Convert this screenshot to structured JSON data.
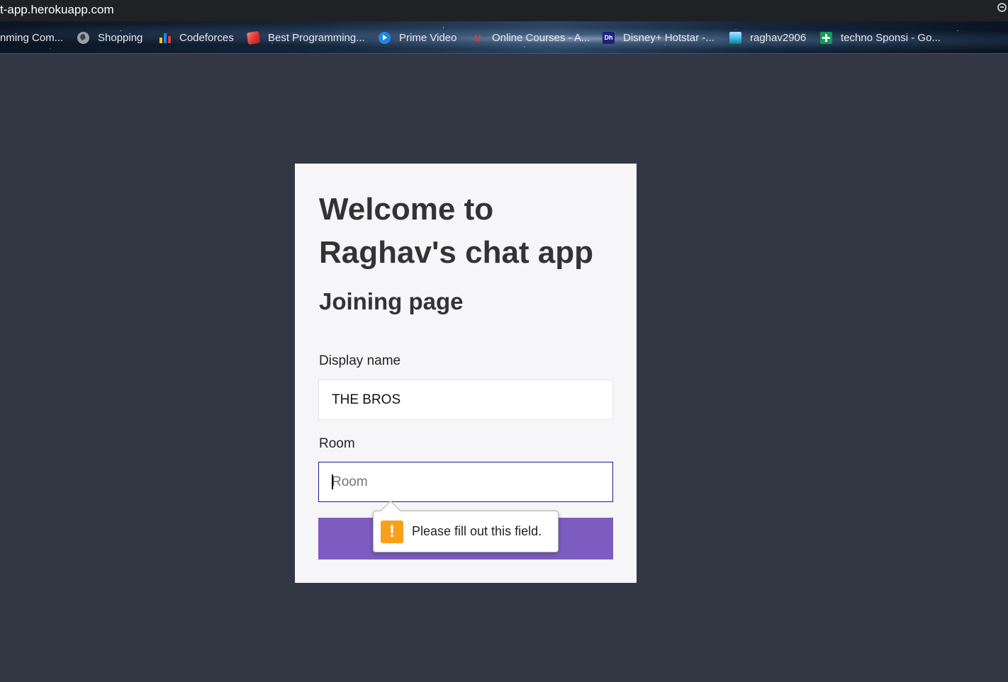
{
  "browser": {
    "url": "t-app.herokuapp.com",
    "bookmarks": [
      {
        "label": "nming Com...",
        "icon": "none"
      },
      {
        "label": "Shopping",
        "icon": "globe-icon"
      },
      {
        "label": "Codeforces",
        "icon": "codeforces-icon"
      },
      {
        "label": "Best Programming...",
        "icon": "box-icon"
      },
      {
        "label": "Prime Video",
        "icon": "prime-video-icon"
      },
      {
        "label": "Online Courses - A...",
        "icon": "online-courses-icon"
      },
      {
        "label": "Disney+ Hotstar -...",
        "icon": "hotstar-icon"
      },
      {
        "label": "raghav2906",
        "icon": "avatar-icon"
      },
      {
        "label": "techno Sponsi - Go...",
        "icon": "sheets-icon"
      }
    ]
  },
  "card": {
    "title": "Welcome to Raghav's chat app",
    "subtitle": "Joining page",
    "display_name_label": "Display name",
    "display_name_value": "THE BROS",
    "room_label": "Room",
    "room_placeholder": "Room",
    "room_value": ""
  },
  "validation": {
    "message": "Please fill out this field.",
    "icon": "warning-icon"
  },
  "colors": {
    "page_bg": "#333744",
    "card_bg": "#f6f6f9",
    "button": "#7c5cbf",
    "focus_border": "#1a1a8c",
    "warning": "#f9a01b"
  }
}
